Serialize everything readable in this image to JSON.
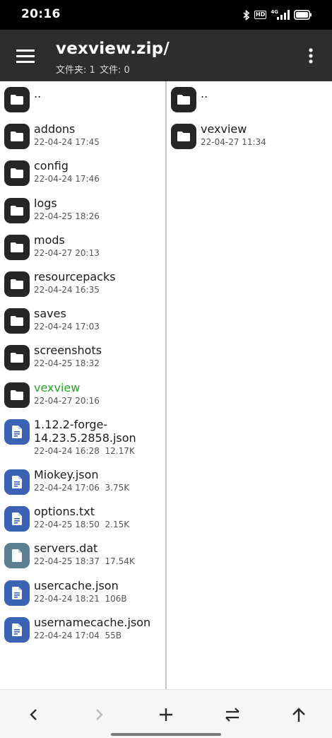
{
  "status_bar": {
    "time": "20:16",
    "hd": "HD",
    "network": "4G",
    "icons": [
      "bluetooth-icon",
      "hd-icon",
      "signal-icon",
      "battery-icon"
    ]
  },
  "app_bar": {
    "title": "vexview.zip/",
    "folders_label": "文件夹: 1",
    "files_label": "文件: 0"
  },
  "left_pane": {
    "items": [
      {
        "name": "..",
        "meta": "",
        "kind": "folder"
      },
      {
        "name": "addons",
        "meta": "22-04-24 17:45",
        "kind": "folder"
      },
      {
        "name": "config",
        "meta": "22-04-24 17:46",
        "kind": "folder"
      },
      {
        "name": "logs",
        "meta": "22-04-25 18:26",
        "kind": "folder"
      },
      {
        "name": "mods",
        "meta": "22-04-27 20:13",
        "kind": "folder"
      },
      {
        "name": "resourcepacks",
        "meta": "22-04-24 16:35",
        "kind": "folder"
      },
      {
        "name": "saves",
        "meta": "22-04-24 17:03",
        "kind": "folder"
      },
      {
        "name": "screenshots",
        "meta": "22-04-25 18:32",
        "kind": "folder"
      },
      {
        "name": "vexview",
        "meta": "22-04-27 20:16",
        "kind": "folder",
        "highlight": true
      },
      {
        "name": "1.12.2-forge-14.23.5.2858.json",
        "meta": "22-04-24 16:28  12.17K",
        "kind": "doc"
      },
      {
        "name": "Miokey.json",
        "meta": "22-04-24 17:06  3.75K",
        "kind": "doc"
      },
      {
        "name": "options.txt",
        "meta": "22-04-25 18:50  2.15K",
        "kind": "doc"
      },
      {
        "name": "servers.dat",
        "meta": "22-04-25 18:37  17.54K",
        "kind": "dat"
      },
      {
        "name": "usercache.json",
        "meta": "22-04-24 18:21  106B",
        "kind": "doc"
      },
      {
        "name": "usernamecache.json",
        "meta": "22-04-24 17:04  55B",
        "kind": "doc"
      }
    ]
  },
  "right_pane": {
    "items": [
      {
        "name": "..",
        "meta": "",
        "kind": "folder"
      },
      {
        "name": "vexview",
        "meta": "22-04-27 11:34",
        "kind": "folder"
      }
    ]
  },
  "bottom_bar": {
    "buttons": [
      "back-icon",
      "forward-icon",
      "add-icon",
      "swap-icon",
      "up-icon"
    ],
    "forward_enabled": false
  },
  "colors": {
    "app_bar": "#2d2d2d",
    "folder_icon": "#262626",
    "doc_icon": "#3b63b3",
    "dat_icon": "#5d7f92",
    "highlight": "#27a427"
  }
}
